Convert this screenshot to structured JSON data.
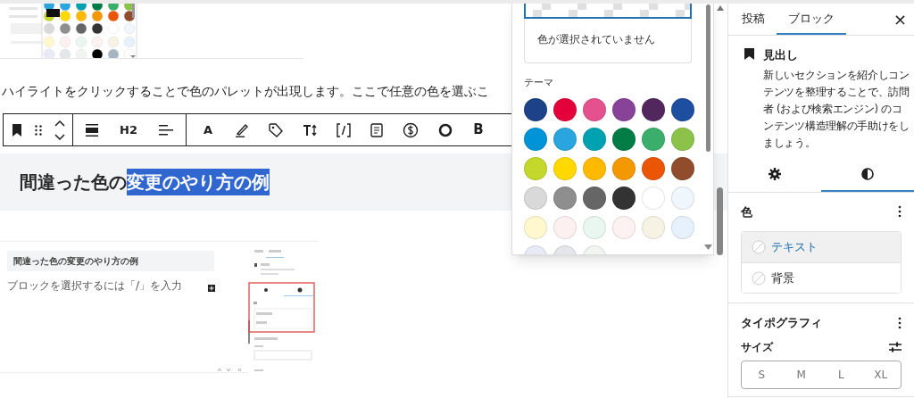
{
  "paragraph": "ハイライトをクリックすることで色のパレットが出現します。ここで任意の色を選ぶこ",
  "toolbar": {
    "heading_level": "H2",
    "text_button": "A",
    "bold_button": "B"
  },
  "heading_block": {
    "plain": "間違った色の",
    "highlighted": "変更のやり方の例"
  },
  "embedded_screenshot": {
    "heading": "間違った色の変更のやり方の例",
    "placeholder": "ブロックを選択するには「/」を入力"
  },
  "color_popover": {
    "status": "色が選択されていません",
    "palette_heading": "テーマ",
    "swatches": [
      {
        "color": "#1d4289"
      },
      {
        "color": "#e4003a"
      },
      {
        "color": "#e5508e"
      },
      {
        "color": "#884399"
      },
      {
        "color": "#52275d"
      },
      {
        "color": "#1d4ea0"
      },
      {
        "color": "#0093d8"
      },
      {
        "color": "#2ba5df"
      },
      {
        "color": "#00a1b0"
      },
      {
        "color": "#007c44"
      },
      {
        "color": "#3aae6b"
      },
      {
        "color": "#8bc34a"
      },
      {
        "color": "#c4d82c"
      },
      {
        "color": "#ffd800"
      },
      {
        "color": "#ffb900"
      },
      {
        "color": "#f39800"
      },
      {
        "color": "#ea5506"
      },
      {
        "color": "#914c2c"
      },
      {
        "color": "#d9d9d9"
      },
      {
        "color": "#8e8e8e"
      },
      {
        "color": "#666666"
      },
      {
        "color": "#333333"
      },
      {
        "color": "#ffffff"
      },
      {
        "color": "#f0f7fc"
      },
      {
        "color": "#fff8cf"
      },
      {
        "color": "#fcf0f0"
      },
      {
        "color": "#eaf6f0"
      },
      {
        "color": "#fdf1f1"
      },
      {
        "color": "#f7f3e4"
      },
      {
        "color": "#e6f1fc"
      },
      {
        "color": "#e8ebf7"
      },
      {
        "color": "#e3e6ea"
      },
      {
        "color": "#f1f5f2"
      }
    ]
  },
  "sidebar": {
    "tabs": [
      {
        "label": "投稿",
        "selected": false
      },
      {
        "label": "ブロック",
        "selected": true
      }
    ],
    "close": "×",
    "block": {
      "title": "見出し",
      "description": "新しいセクションを紹介しコンテンツを整理することで、訪問者 (および検索エンジン) のコンテンツ構造理解の手助けをしましょう。"
    },
    "panel_tabs": [
      {
        "kind": "settings",
        "selected": false
      },
      {
        "kind": "styles",
        "selected": true
      }
    ],
    "color": {
      "heading": "色",
      "items": [
        {
          "label": "テキスト",
          "selected": true
        },
        {
          "label": "背景",
          "selected": false
        }
      ]
    },
    "typography": {
      "heading": "タイポグラフィ",
      "size_label": "サイズ",
      "sizes": [
        {
          "label": "S",
          "selected": false
        },
        {
          "label": "M",
          "selected": false
        },
        {
          "label": "L",
          "selected": false
        },
        {
          "label": "XL",
          "selected": false
        }
      ]
    }
  }
}
